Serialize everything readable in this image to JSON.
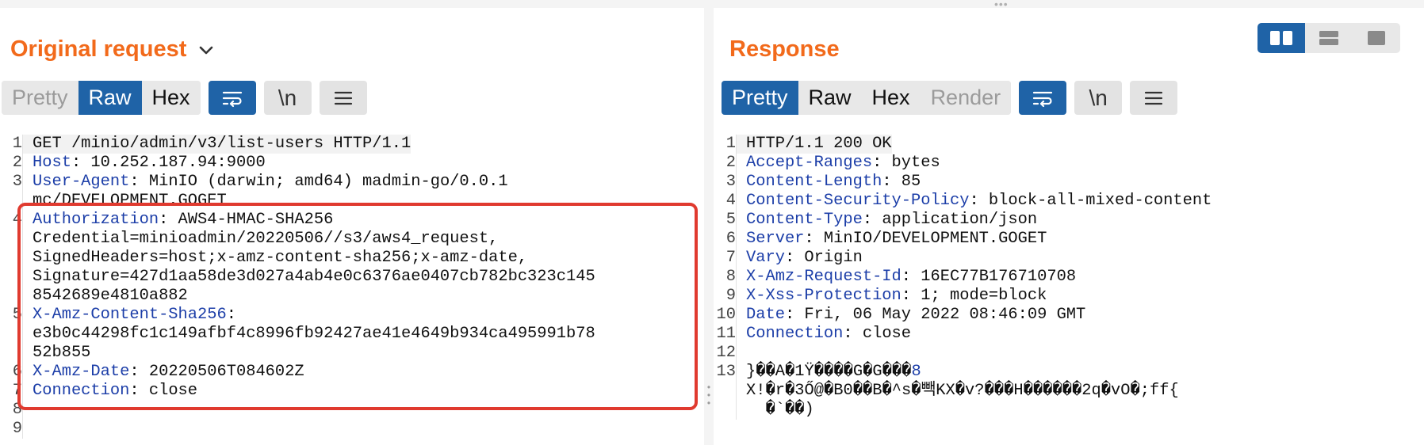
{
  "request": {
    "title": "Original request",
    "tabs": [
      {
        "label": "Pretty",
        "state": "disabled"
      },
      {
        "label": "Raw",
        "state": "active"
      },
      {
        "label": "Hex",
        "state": "normal"
      }
    ],
    "newline_button": "\\n",
    "lines": [
      {
        "n": "1",
        "key": "",
        "text": "GET /minio/admin/v3/list-users HTTP/1.1"
      },
      {
        "n": "2",
        "key": "Host",
        "text": ": 10.252.187.94:9000"
      },
      {
        "n": "3",
        "key": "User-Agent",
        "text": ": MinIO (darwin; amd64) madmin-go/0.0.1"
      },
      {
        "n": "",
        "key": "",
        "text": "mc/DEVELOPMENT.GOGET"
      },
      {
        "n": "4",
        "key": "Authorization",
        "text": ": AWS4-HMAC-SHA256"
      },
      {
        "n": "",
        "key": "",
        "text": "Credential=minioadmin/20220506//s3/aws4_request,"
      },
      {
        "n": "",
        "key": "",
        "text": "SignedHeaders=host;x-amz-content-sha256;x-amz-date,"
      },
      {
        "n": "",
        "key": "",
        "text": "Signature=427d1aa58de3d027a4ab4e0c6376ae0407cb782bc323c145"
      },
      {
        "n": "",
        "key": "",
        "text": "8542689e4810a882"
      },
      {
        "n": "5",
        "key": "X-Amz-Content-Sha256",
        "text": ":"
      },
      {
        "n": "",
        "key": "",
        "text": "e3b0c44298fc1c149afbf4c8996fb92427ae41e4649b934ca495991b78"
      },
      {
        "n": "",
        "key": "",
        "text": "52b855"
      },
      {
        "n": "6",
        "key": "X-Amz-Date",
        "text": ": 20220506T084602Z"
      },
      {
        "n": "7",
        "key": "Connection",
        "text": ": close"
      },
      {
        "n": "8",
        "key": "",
        "text": ""
      },
      {
        "n": "9",
        "key": "",
        "text": ""
      }
    ]
  },
  "response": {
    "title": "Response",
    "tabs": [
      {
        "label": "Pretty",
        "state": "active"
      },
      {
        "label": "Raw",
        "state": "normal"
      },
      {
        "label": "Hex",
        "state": "normal"
      },
      {
        "label": "Render",
        "state": "disabled"
      }
    ],
    "newline_button": "\\n",
    "lines": [
      {
        "n": "1",
        "key": "",
        "text": "HTTP/1.1 200 OK"
      },
      {
        "n": "2",
        "key": "Accept-Ranges",
        "text": ": bytes"
      },
      {
        "n": "3",
        "key": "Content-Length",
        "text": ": 85"
      },
      {
        "n": "4",
        "key": "Content-Security-Policy",
        "text": ": block-all-mixed-content"
      },
      {
        "n": "5",
        "key": "Content-Type",
        "text": ": application/json"
      },
      {
        "n": "6",
        "key": "Server",
        "text": ": MinIO/DEVELOPMENT.GOGET"
      },
      {
        "n": "7",
        "key": "Vary",
        "text": ": Origin"
      },
      {
        "n": "8",
        "key": "X-Amz-Request-Id",
        "text": ": 16EC77B176710708"
      },
      {
        "n": "9",
        "key": "X-Xss-Protection",
        "text": ": 1; mode=block"
      },
      {
        "n": "10",
        "key": "Date",
        "text": ": Fri, 06 May 2022 08:46:09 GMT"
      },
      {
        "n": "11",
        "key": "Connection",
        "text": ": close"
      },
      {
        "n": "12",
        "key": "",
        "text": ""
      },
      {
        "n": "13",
        "key": "",
        "text": "}��A�1Ÿ����G�G���",
        "tail": "8"
      },
      {
        "n": "",
        "key": "",
        "text": "X!�r�3Ő@�B0��B�^s�빽KX�v?���H������2q�vO�;ff{"
      },
      {
        "n": "",
        "key": "",
        "text": "  �`��)"
      }
    ]
  },
  "colors": {
    "title": "#f26a1b",
    "active_tab": "#1f63a7",
    "header_key": "#1c3ea8",
    "highlight_box": "#e03a2f"
  }
}
